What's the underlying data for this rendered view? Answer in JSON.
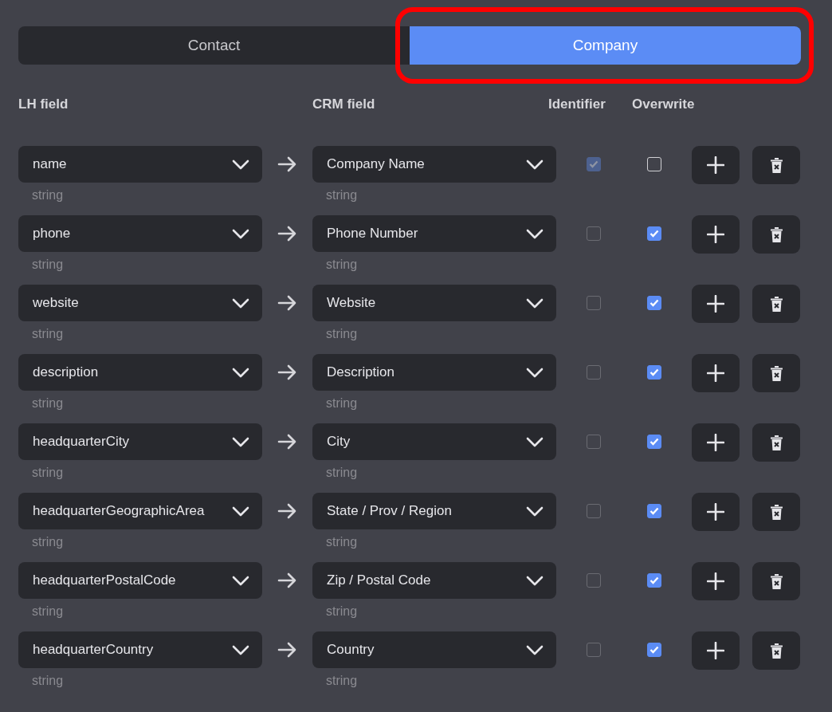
{
  "tabs": [
    {
      "label": "Contact",
      "selected": false,
      "highlighted": false
    },
    {
      "label": "Company",
      "selected": true,
      "highlighted": true
    }
  ],
  "columns": {
    "lh": "LH field",
    "crm": "CRM field",
    "identifier": "Identifier",
    "overwrite": "Overwrite"
  },
  "rows": [
    {
      "lh_field": "name",
      "lh_type": "string",
      "crm_field": "Company Name",
      "crm_type": "string",
      "identifier": {
        "checked": true,
        "disabled": true
      },
      "overwrite": {
        "checked": false
      }
    },
    {
      "lh_field": "phone",
      "lh_type": "string",
      "crm_field": "Phone Number",
      "crm_type": "string",
      "identifier": {
        "checked": false,
        "disabled": true
      },
      "overwrite": {
        "checked": true
      }
    },
    {
      "lh_field": "website",
      "lh_type": "string",
      "crm_field": "Website",
      "crm_type": "string",
      "identifier": {
        "checked": false,
        "disabled": true
      },
      "overwrite": {
        "checked": true
      }
    },
    {
      "lh_field": "description",
      "lh_type": "string",
      "crm_field": "Description",
      "crm_type": "string",
      "identifier": {
        "checked": false,
        "disabled": true
      },
      "overwrite": {
        "checked": true
      }
    },
    {
      "lh_field": "headquarterCity",
      "lh_type": "string",
      "crm_field": "City",
      "crm_type": "string",
      "identifier": {
        "checked": false,
        "disabled": true
      },
      "overwrite": {
        "checked": true
      }
    },
    {
      "lh_field": "headquarterGeographicArea",
      "lh_type": "string",
      "crm_field": "State / Prov / Region",
      "crm_type": "string",
      "identifier": {
        "checked": false,
        "disabled": true
      },
      "overwrite": {
        "checked": true
      }
    },
    {
      "lh_field": "headquarterPostalCode",
      "lh_type": "string",
      "crm_field": "Zip / Postal Code",
      "crm_type": "string",
      "identifier": {
        "checked": false,
        "disabled": true
      },
      "overwrite": {
        "checked": true
      }
    },
    {
      "lh_field": "headquarterCountry",
      "lh_type": "string",
      "crm_field": "Country",
      "crm_type": "string",
      "identifier": {
        "checked": false,
        "disabled": true
      },
      "overwrite": {
        "checked": true
      }
    }
  ]
}
